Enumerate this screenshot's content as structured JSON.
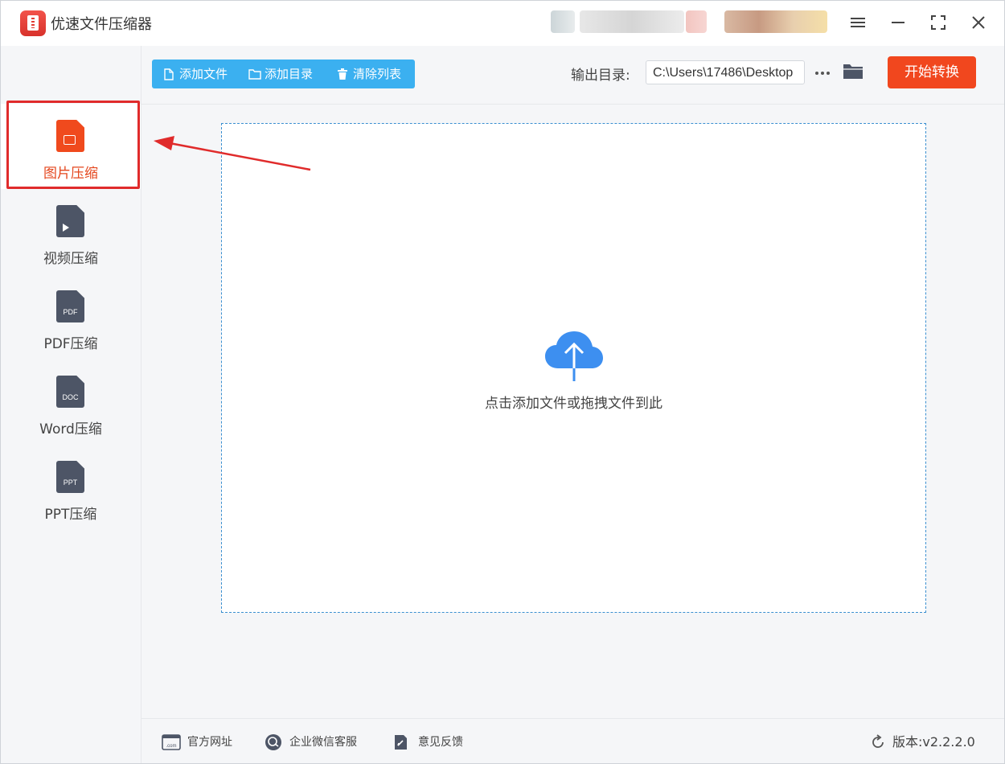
{
  "app": {
    "title": "优速文件压缩器"
  },
  "sidebar": {
    "items": [
      {
        "label": "图片压缩",
        "icon": "image-file-icon",
        "active": true
      },
      {
        "label": "视频压缩",
        "icon": "video-file-icon",
        "active": false
      },
      {
        "label": "PDF压缩",
        "icon": "pdf-file-icon",
        "tag": "PDF",
        "active": false
      },
      {
        "label": "Word压缩",
        "icon": "doc-file-icon",
        "tag": "DOC",
        "active": false
      },
      {
        "label": "PPT压缩",
        "icon": "ppt-file-icon",
        "tag": "PPT",
        "active": false
      }
    ]
  },
  "toolbar": {
    "add_file": "添加文件",
    "add_dir": "添加目录",
    "clear_list": "清除列表",
    "output_label": "输出目录:",
    "output_path": "C:\\Users\\17486\\Desktop",
    "start": "开始转换"
  },
  "dropzone": {
    "text": "点击添加文件或拖拽文件到此"
  },
  "footer": {
    "site": "官方网址",
    "wechat": "企业微信客服",
    "feedback": "意见反馈",
    "version": "版本:v2.2.2.0"
  },
  "colors": {
    "accent": "#f1471e",
    "toolbar_blue": "#3bb0f0",
    "highlight_red": "#e02b2b",
    "cloud_blue": "#3d8ff0"
  }
}
